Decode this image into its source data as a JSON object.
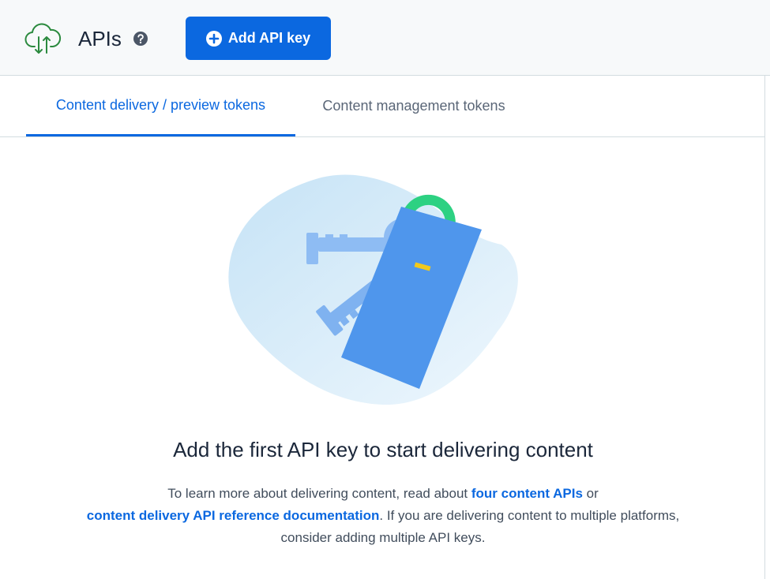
{
  "header": {
    "title": "APIs",
    "add_button_label": "Add API key",
    "icons": {
      "app": "cloud-upload-icon",
      "help": "question-circle-icon",
      "add": "plus-circle-icon"
    }
  },
  "tabs": [
    {
      "label": "Content delivery / preview tokens",
      "active": true
    },
    {
      "label": "Content management tokens",
      "active": false
    }
  ],
  "empty_state": {
    "title": "Add the first API key to start delivering content",
    "text_1": "To learn more about delivering content, read about ",
    "link_1": "four content APIs",
    "text_2": " or ",
    "link_2": "content delivery API reference documentation",
    "text_3": ". If you are delivering content to multiple platforms, consider adding multiple API keys."
  },
  "colors": {
    "primary": "#0b68e0",
    "icon_green": "#2b8a3e",
    "tag_green": "#2dd182",
    "tag_blue": "#4f96ec",
    "blob": "#d8ecfa",
    "text_dark": "#1b273a",
    "text_muted": "#5a6677"
  }
}
